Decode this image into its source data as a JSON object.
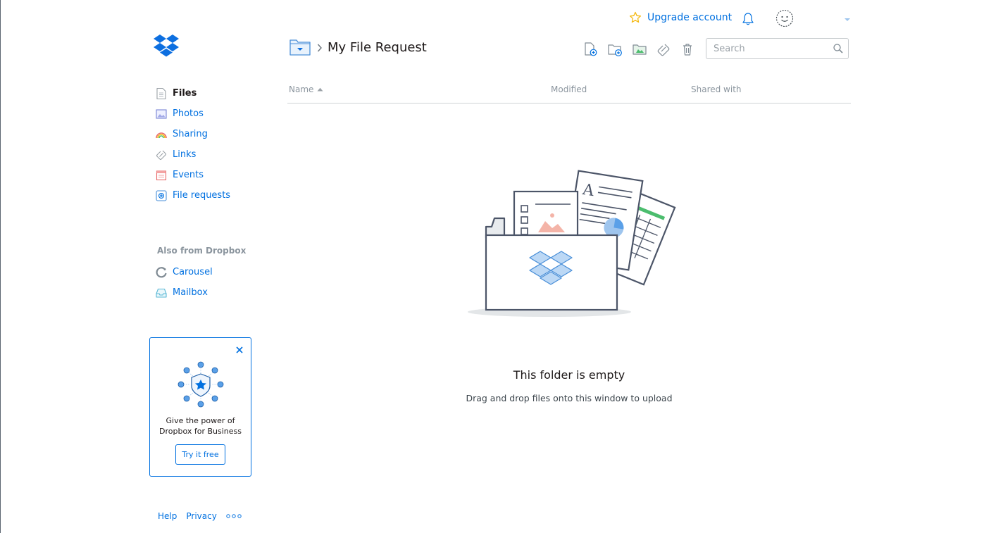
{
  "header": {
    "upgrade_label": "Upgrade account",
    "icons": {
      "upgrade": "star-icon",
      "notifications": "bell-icon",
      "avatar": "smiley-avatar",
      "menu": "caret-down-icon"
    }
  },
  "breadcrumb": {
    "folder_icon": "folder-dropdown-icon",
    "separator": "chevron-right-icon",
    "title": "My File Request"
  },
  "toolbar": {
    "actions": [
      "new-file-icon",
      "new-folder-icon",
      "shared-folder-icon",
      "link-icon",
      "trash-icon"
    ],
    "search_placeholder": "Search"
  },
  "sidebar": {
    "items": [
      {
        "label": "Files",
        "icon": "files-icon",
        "active": true
      },
      {
        "label": "Photos",
        "icon": "photos-icon",
        "active": false
      },
      {
        "label": "Sharing",
        "icon": "rainbow-icon",
        "active": false
      },
      {
        "label": "Links",
        "icon": "link-icon",
        "active": false
      },
      {
        "label": "Events",
        "icon": "calendar-icon",
        "active": false
      },
      {
        "label": "File requests",
        "icon": "file-request-icon",
        "active": false
      }
    ],
    "also_title": "Also from Dropbox",
    "also_items": [
      {
        "label": "Carousel",
        "icon": "carousel-icon"
      },
      {
        "label": "Mailbox",
        "icon": "mailbox-icon"
      }
    ]
  },
  "promo": {
    "text_line1": "Give the power of",
    "text_line2": "Dropbox for Business",
    "button_label": "Try it free"
  },
  "footer": {
    "help": "Help",
    "privacy": "Privacy"
  },
  "table": {
    "col_name": "Name",
    "col_modified": "Modified",
    "col_shared": "Shared with"
  },
  "empty_state": {
    "title": "This folder is empty",
    "subtitle": "Drag and drop files onto this window to upload"
  },
  "colors": {
    "accent": "#0070e0",
    "text": "#1e1919",
    "muted": "#8b959e"
  }
}
